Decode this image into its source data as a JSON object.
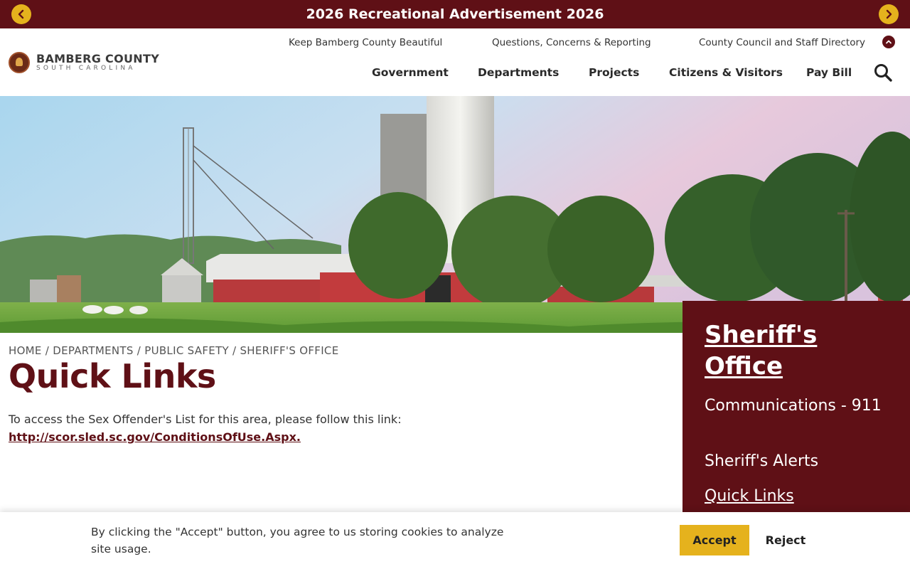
{
  "announcement": {
    "title": "2026 Recreational Advertisement 2026",
    "prev_icon": "chevron-left-icon",
    "next_icon": "chevron-right-icon"
  },
  "header": {
    "logo_name": "BAMBERG COUNTY",
    "logo_sub": "SOUTH CAROLINA",
    "utility_links": [
      "Keep Bamberg County Beautiful",
      "Questions, Concerns & Reporting",
      "County Council and Staff Directory"
    ],
    "main_nav": [
      "Government",
      "Departments",
      "Projects",
      "Citizens & Visitors",
      "Pay Bill"
    ],
    "search_icon": "search-icon"
  },
  "breadcrumb": [
    "HOME",
    "DEPARTMENTS",
    "PUBLIC SAFETY",
    "SHERIFF'S OFFICE"
  ],
  "breadcrumb_separator": "/",
  "main": {
    "title": "Quick Links",
    "body_text": "To access the Sex Offender's List for this area, please follow this link:",
    "link_text": "http://scor.sled.sc.gov/ConditionsOfUse.Aspx."
  },
  "sidebar": {
    "title": "Sheriff's Office",
    "items": [
      "Communications - 911",
      "Sheriff's Alerts",
      "Quick Links"
    ]
  },
  "cookie": {
    "text": "By clicking the \"Accept\" button, you agree to us storing cookies to analyze site usage.",
    "accept_label": "Accept",
    "reject_label": "Reject"
  },
  "colors": {
    "brand_maroon": "#5f1016",
    "accent_gold": "#e5b21d"
  }
}
